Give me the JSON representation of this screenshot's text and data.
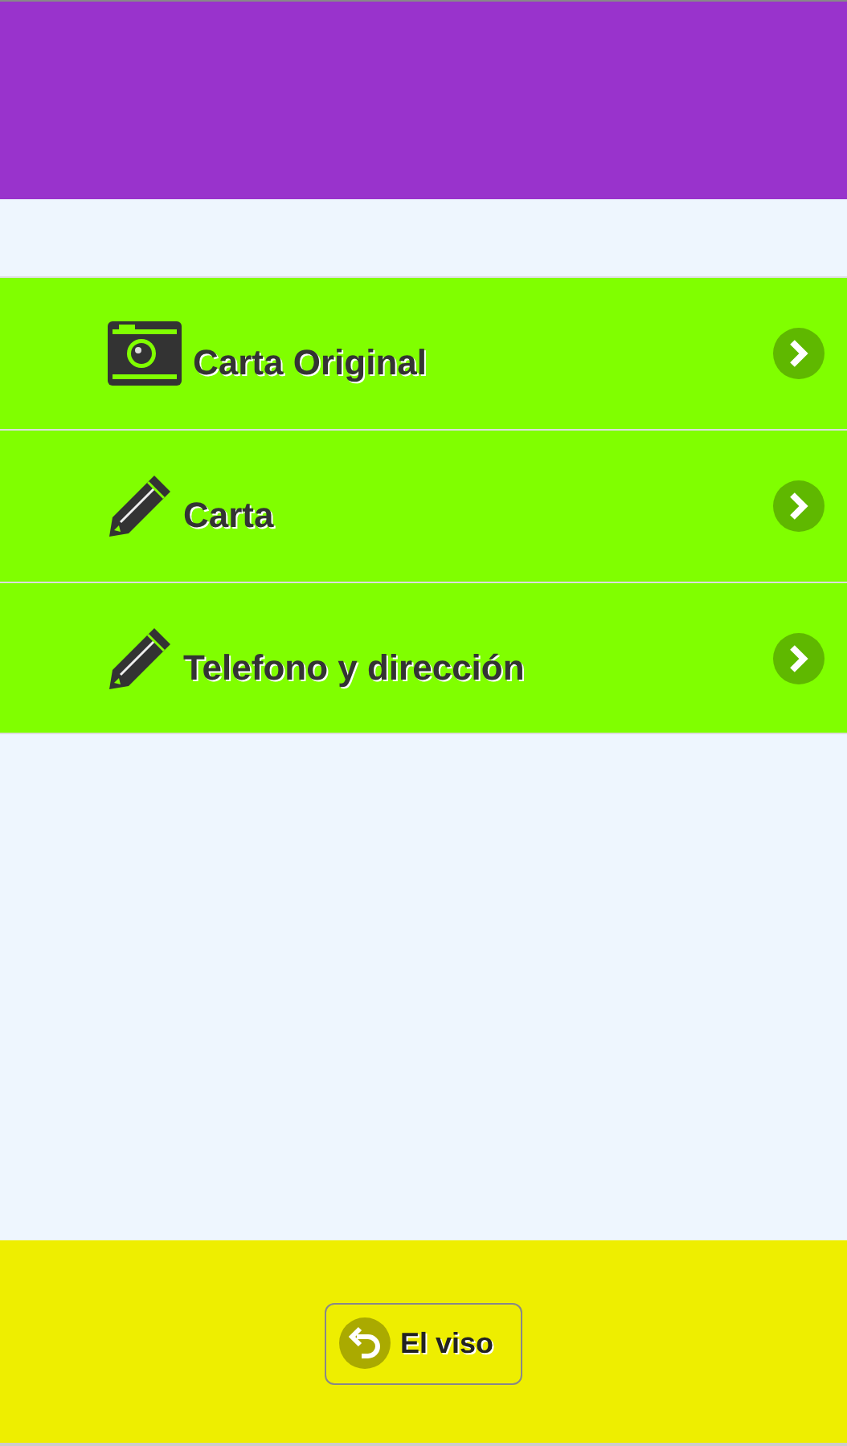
{
  "menu": [
    {
      "kind": "camera",
      "label": "Carta Original"
    },
    {
      "kind": "pencil",
      "label": "Carta"
    },
    {
      "kind": "pencil",
      "label": "Telefono y dirección"
    }
  ],
  "footer": {
    "button": "El viso"
  }
}
